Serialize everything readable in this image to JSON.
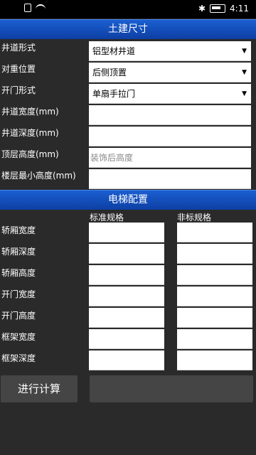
{
  "status_bar": {
    "time": "4:11"
  },
  "civil": {
    "title": "土建尺寸",
    "shaft_type": {
      "label": "井道形式",
      "value": "铝型材井道"
    },
    "counterweight": {
      "label": "对重位置",
      "value": "后侧顶置"
    },
    "door_type": {
      "label": "开门形式",
      "value": "单扇手拉门"
    },
    "shaft_width": {
      "label": "井道宽度(mm)",
      "value": ""
    },
    "shaft_depth": {
      "label": "井道深度(mm)",
      "value": ""
    },
    "top_height": {
      "label": "顶层高度(mm)",
      "placeholder": "装饰后高度"
    },
    "min_floor_height": {
      "label": "楼层最小高度(mm)",
      "value": ""
    }
  },
  "elevator": {
    "title": "电梯配置",
    "col_standard": "标准规格",
    "col_nonstandard": "非标规格",
    "rows": [
      "轿厢宽度",
      "轿厢深度",
      "轿厢高度",
      "开门宽度",
      "开门高度",
      "框架宽度",
      "框架深度"
    ]
  },
  "actions": {
    "calculate": "进行计算",
    "result": ""
  }
}
